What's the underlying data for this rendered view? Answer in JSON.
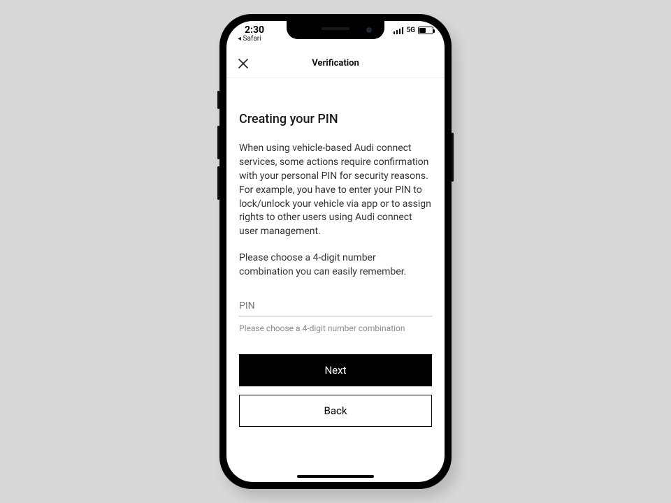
{
  "statusbar": {
    "time": "2:30",
    "back_app": "◂ Safari",
    "network": "5G"
  },
  "header": {
    "title": "Verification"
  },
  "page": {
    "heading": "Creating your PIN",
    "body1": "When using vehicle-based Audi connect services, some actions require confirmation with your personal PIN for security reasons. For example, you have to enter your PIN to lock/unlock your vehicle via app or to assign rights to other users using Audi connect user management.",
    "body2": "Please choose a 4-digit number combination you can easily remember.",
    "pin_label": "PIN",
    "pin_hint": "Please choose a 4-digit number combination"
  },
  "buttons": {
    "next": "Next",
    "back": "Back"
  }
}
